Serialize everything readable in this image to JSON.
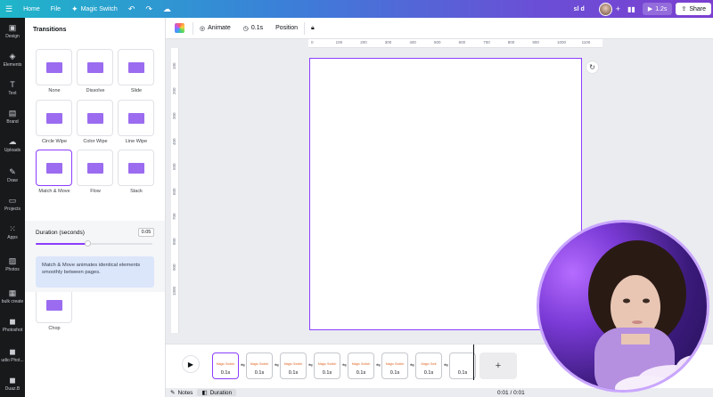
{
  "topbar": {
    "menu_icon": "hamburger-icon",
    "home": "Home",
    "file": "File",
    "magic_switch": "Magic Switch",
    "doc_name": "sl d",
    "time_btn": "1.2s",
    "share": "Share"
  },
  "rail": [
    {
      "label": "Design",
      "icon": "layout-icon",
      "glyph": "▣"
    },
    {
      "label": "Elements",
      "icon": "shapes-icon",
      "glyph": "◈"
    },
    {
      "label": "Text",
      "icon": "text-icon",
      "glyph": "T"
    },
    {
      "label": "Brand",
      "icon": "briefcase-icon",
      "glyph": "▤"
    },
    {
      "label": "Uploads",
      "icon": "cloud-upload-icon",
      "glyph": "☁"
    },
    {
      "label": "Draw",
      "icon": "pen-icon",
      "glyph": "✎"
    },
    {
      "label": "Projects",
      "icon": "folder-icon",
      "glyph": "▭"
    },
    {
      "label": "Apps",
      "icon": "apps-grid-icon",
      "glyph": "⁙"
    },
    {
      "label": "Photos",
      "icon": "image-icon",
      "glyph": "▨"
    },
    {
      "label": "bulk create",
      "icon": "bulk-create-icon",
      "glyph": "▦"
    },
    {
      "label": "Photoshot",
      "icon": "photoshot-app-icon",
      "glyph": "◼"
    },
    {
      "label": "udio Phot...",
      "icon": "studio-photo-app-icon",
      "glyph": "◼"
    },
    {
      "label": "Duaz.B",
      "icon": "app-icon",
      "glyph": "◼"
    }
  ],
  "panel": {
    "title": "Transitions",
    "transitions": [
      {
        "label": "None",
        "selected": false
      },
      {
        "label": "Dissolve",
        "selected": false
      },
      {
        "label": "Slide",
        "selected": false
      },
      {
        "label": "Circle Wipe",
        "selected": false
      },
      {
        "label": "Color Wipe",
        "selected": false
      },
      {
        "label": "Line Wipe",
        "selected": false
      },
      {
        "label": "Match & Move",
        "selected": true
      },
      {
        "label": "Flow",
        "selected": false
      },
      {
        "label": "Stack",
        "selected": false
      },
      {
        "label": "Chop",
        "selected": false
      }
    ],
    "duration_label": "Duration (seconds)",
    "duration_value": "0.05",
    "duration_fraction": 0.45,
    "info": "Match & Move animates identical elements smoothly between pages."
  },
  "toolbar": {
    "animate": "Animate",
    "time": "0.1s",
    "position": "Position"
  },
  "rulers": {
    "top": [
      "0",
      "100",
      "200",
      "300",
      "400",
      "500",
      "600",
      "700",
      "800",
      "900",
      "1000",
      "1100"
    ],
    "left": [
      "100",
      "200",
      "300",
      "400",
      "500",
      "600",
      "700",
      "800",
      "900",
      "1000"
    ]
  },
  "timeline": {
    "pages": [
      {
        "duration": "0.1s",
        "caption": "Magic Switch",
        "selected": true
      },
      {
        "duration": "0.1s",
        "caption": "Magic Switch",
        "selected": false
      },
      {
        "duration": "0.1s",
        "caption": "Magic Switch",
        "selected": false
      },
      {
        "duration": "0.1s",
        "caption": "Magic Switch",
        "selected": false
      },
      {
        "duration": "0.1s",
        "caption": "Magic Switch",
        "selected": false
      },
      {
        "duration": "0.1s",
        "caption": "Magic Switch",
        "selected": false
      },
      {
        "duration": "0.1s",
        "caption": "Magic Swit",
        "selected": false
      },
      {
        "duration": "0.1s",
        "caption": "",
        "selected": false
      }
    ],
    "add_page": "+"
  },
  "bottombar": {
    "notes": "Notes",
    "duration": "Duration",
    "time": "0:01 / 0:01"
  },
  "colors": {
    "accent": "#8b3dff",
    "tile_fill": "#9b6cf0",
    "rail_bg": "#18191b"
  }
}
